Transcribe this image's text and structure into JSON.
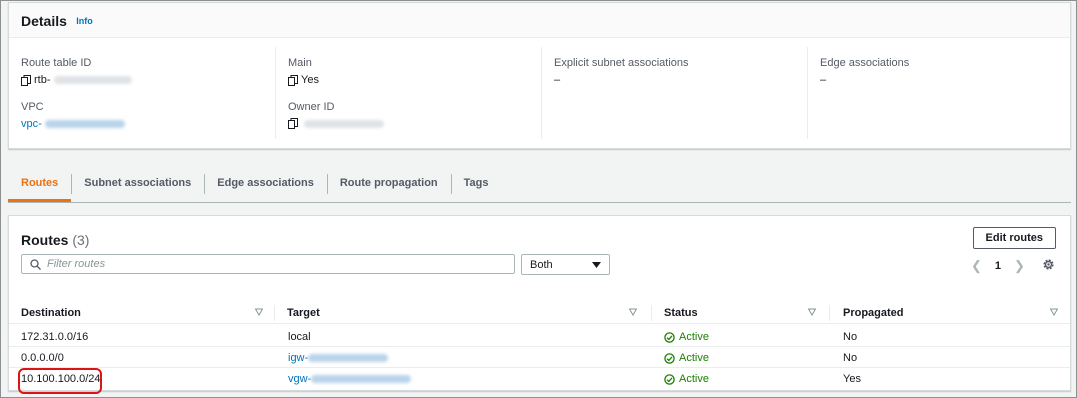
{
  "details": {
    "title": "Details",
    "info_label": "Info",
    "fields": {
      "route_table_id": {
        "label": "Route table ID",
        "value": "rtb-"
      },
      "vpc": {
        "label": "VPC",
        "value": "vpc-"
      },
      "main": {
        "label": "Main",
        "value": "Yes"
      },
      "owner_id": {
        "label": "Owner ID",
        "value": ""
      },
      "explicit_subnet": {
        "label": "Explicit subnet associations",
        "value": "–"
      },
      "edge_assoc": {
        "label": "Edge associations",
        "value": "–"
      }
    }
  },
  "tabs": [
    {
      "label": "Routes",
      "active": true
    },
    {
      "label": "Subnet associations",
      "active": false
    },
    {
      "label": "Edge associations",
      "active": false
    },
    {
      "label": "Route propagation",
      "active": false
    },
    {
      "label": "Tags",
      "active": false
    }
  ],
  "routes": {
    "title": "Routes",
    "count": "(3)",
    "edit_button": "Edit routes",
    "filter_placeholder": "Filter routes",
    "select_value": "Both",
    "page": "1",
    "columns": [
      "Destination",
      "Target",
      "Status",
      "Propagated"
    ],
    "rows": [
      {
        "destination": "172.31.0.0/16",
        "target": "local",
        "target_link": false,
        "status": "Active",
        "propagated": "No"
      },
      {
        "destination": "0.0.0.0/0",
        "target": "igw-",
        "target_link": true,
        "status": "Active",
        "propagated": "No"
      },
      {
        "destination": "10.100.100.0/24",
        "target": "vgw-",
        "target_link": true,
        "status": "Active",
        "propagated": "Yes"
      }
    ]
  },
  "colors": {
    "accent": "#ec7211",
    "link": "#0073bb",
    "success": "#1d8102",
    "highlight": "#d91515"
  },
  "icons": [
    "copy-icon",
    "search-icon",
    "caret-down-icon",
    "chevron-left-icon",
    "chevron-right-icon",
    "gear-icon",
    "sort-icon",
    "status-check-icon"
  ]
}
